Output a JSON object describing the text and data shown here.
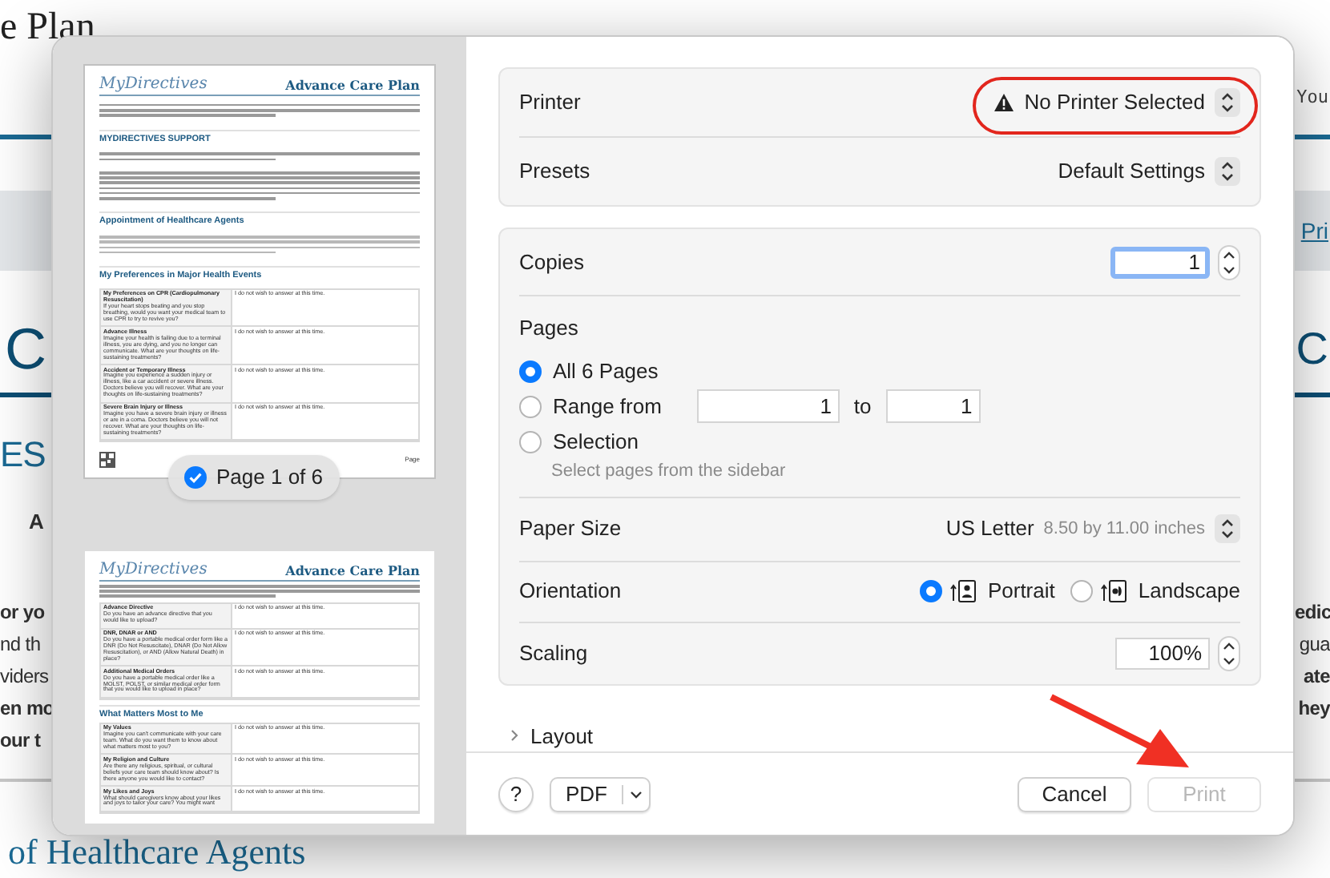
{
  "background_page": {
    "header_title": "e Plan",
    "header_right": "You",
    "print_link": "Pri",
    "heading_left": "C",
    "heading_right": "C",
    "subheading": "ES",
    "subline": "A",
    "paragraph_left": [
      {
        "text": "or yo",
        "bold": true
      },
      {
        "text": "nd th",
        "bold": false
      },
      {
        "text": "viders",
        "bold": false
      },
      {
        "text": "en mo",
        "bold": true
      },
      {
        "text": "our t",
        "bold": true
      }
    ],
    "paragraph_right": [
      {
        "text": "edic",
        "bold": true
      },
      {
        "text": "gua",
        "bold": false
      },
      {
        "text": "ate",
        "bold": true
      },
      {
        "text": "hey",
        "bold": true
      }
    ],
    "section_heading": "of Healthcare Agents"
  },
  "print_dialog": {
    "sidebar": {
      "pages": [
        {
          "selected": true,
          "badge": "Page 1 of 6",
          "logo": "MyDirectives",
          "title": "Advance Care Plan",
          "footer_label": "Page",
          "blocks": [
            {
              "kind": "note"
            },
            {
              "kind": "heading",
              "text": "MYDIRECTIVES SUPPORT"
            },
            {
              "kind": "details"
            },
            {
              "kind": "paragraph"
            },
            {
              "kind": "heading",
              "text": "Appointment of Healthcare Agents"
            },
            {
              "kind": "italic_paragraph"
            },
            {
              "kind": "heading",
              "text": "My Preferences in Major Health Events"
            },
            {
              "kind": "table",
              "rows": [
                {
                  "title": "My Preferences on CPR (Cardiopulmonary Resuscitation)",
                  "description": "If your heart stops beating and you stop breathing, would you want your medical team to use CPR to try to revive you?",
                  "answer": "I do not wish to answer at this time."
                },
                {
                  "title": "Advance Illness",
                  "description": "Imagine your health is failing due to a terminal illness, you are dying, and you no longer can communicate. What are your thoughts on life-sustaining treatments?",
                  "answer": "I do not wish to answer at this time."
                },
                {
                  "title": "Accident or Temporary Illness",
                  "description": "Imagine you experience a sudden injury or illness, like a car accident or severe illness. Doctors believe you will recover. What are your thoughts on life-sustaining treatments?",
                  "answer": "I do not wish to answer at this time."
                },
                {
                  "title": "Severe Brain Injury or Illness",
                  "description": "Imagine you have a severe brain injury or illness or are in a coma. Doctors believe you will not recover. What are your thoughts on life-sustaining treatments?",
                  "answer": "I do not wish to answer at this time."
                }
              ]
            }
          ]
        },
        {
          "selected": false,
          "logo": "MyDirectives",
          "title": "Advance Care Plan",
          "blocks": [
            {
              "kind": "note"
            },
            {
              "kind": "table",
              "rows": [
                {
                  "title": "Advance Directive",
                  "description": "Do you have an advance directive that you would like to upload?",
                  "answer": "I do not wish to answer at this time."
                },
                {
                  "title": "DNR, DNAR or AND",
                  "description": "Do you have a portable medical order form like a DNR (Do Not Resuscitate), DNAR (Do Not Allow Resuscitation), or AND (Allow Natural Death) in place?",
                  "answer": "I do not wish to answer at this time."
                },
                {
                  "title": "Additional Medical Orders",
                  "description": "Do you have a portable medical order like a MOLST, POLST, or similar medical order form that you would like to upload in place?",
                  "answer": "I do not wish to answer at this time."
                }
              ]
            },
            {
              "kind": "heading",
              "text": "What Matters Most to Me"
            },
            {
              "kind": "table",
              "rows": [
                {
                  "title": "My Values",
                  "description": "Imagine you can't communicate with your care team. What do you want them to know about what matters most to you?",
                  "answer": "I do not wish to answer at this time."
                },
                {
                  "title": "My Religion and Culture",
                  "description": "Are there any religious, spiritual, or cultural beliefs your care team should know about? Is there anyone you would like to contact?",
                  "answer": "I do not wish to answer at this time."
                },
                {
                  "title": "My Likes and Joys",
                  "description": "What should caregivers know about your likes and joys to tailor your care? You might want",
                  "answer": "I do not wish to answer at this time."
                }
              ]
            }
          ]
        }
      ]
    },
    "printer": {
      "label": "Printer",
      "value": "No Printer Selected",
      "warning": true
    },
    "presets": {
      "label": "Presets",
      "value": "Default Settings"
    },
    "copies": {
      "label": "Copies",
      "value": "1"
    },
    "pages": {
      "label": "Pages",
      "options": [
        {
          "kind": "plain",
          "label": "All 6 Pages",
          "selected": true
        },
        {
          "kind": "range",
          "label": "Range from",
          "selected": false,
          "from": "1",
          "to_label": "to",
          "to": "1"
        },
        {
          "kind": "hinted",
          "label": "Selection",
          "selected": false,
          "hint": "Select pages from the sidebar"
        }
      ]
    },
    "paper_size": {
      "label": "Paper Size",
      "value": "US Letter",
      "detail": "8.50 by 11.00 inches"
    },
    "orientation": {
      "label": "Orientation",
      "options": [
        {
          "kind": "portrait",
          "label": "Portrait",
          "selected": true
        },
        {
          "kind": "landscape",
          "label": "Landscape",
          "selected": false
        }
      ]
    },
    "scaling": {
      "label": "Scaling",
      "value": "100%"
    },
    "layout_section": {
      "label": "Layout",
      "expanded": false
    },
    "buttons": {
      "help": "?",
      "pdf": "PDF",
      "cancel": "Cancel",
      "print": {
        "label": "Print",
        "disabled": true
      }
    }
  }
}
